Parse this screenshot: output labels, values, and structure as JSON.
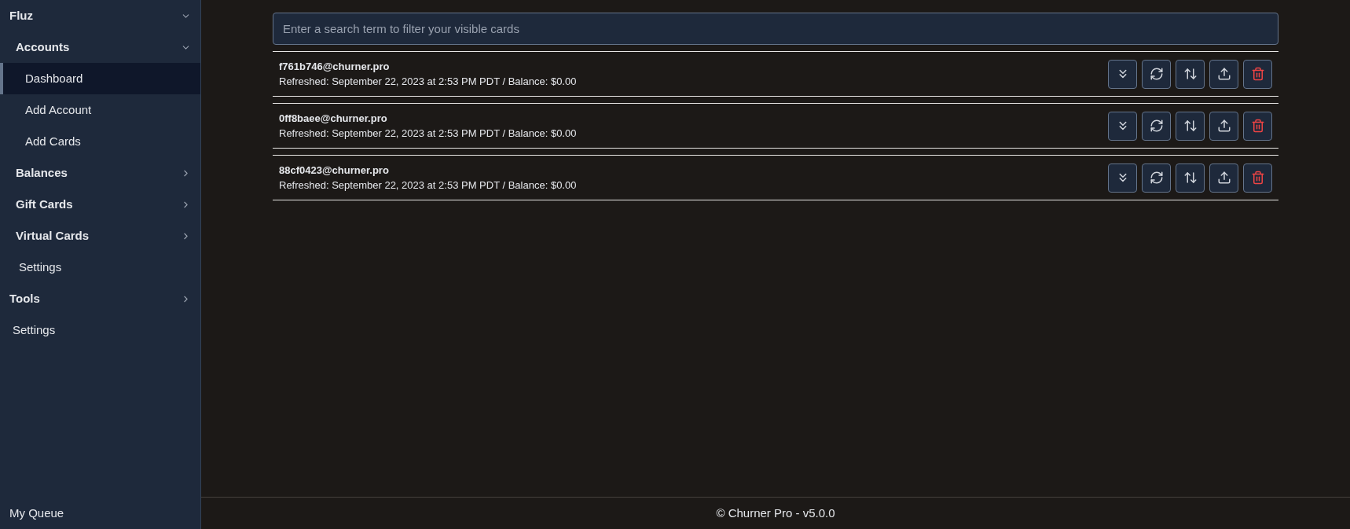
{
  "sidebar": {
    "items": [
      {
        "kind": "group",
        "label": "Fluz",
        "expanded": true,
        "children": [
          {
            "kind": "group",
            "label": "Accounts",
            "expanded": true,
            "children": [
              {
                "kind": "link",
                "label": "Dashboard",
                "selected": true
              },
              {
                "kind": "link",
                "label": "Add Account",
                "selected": false
              },
              {
                "kind": "link",
                "label": "Add Cards",
                "selected": false
              }
            ]
          },
          {
            "kind": "group",
            "label": "Balances",
            "expanded": false
          },
          {
            "kind": "group",
            "label": "Gift Cards",
            "expanded": false
          },
          {
            "kind": "group",
            "label": "Virtual Cards",
            "expanded": false
          },
          {
            "kind": "link",
            "label": "Settings",
            "selected": false
          }
        ]
      },
      {
        "kind": "group",
        "label": "Tools",
        "expanded": false
      },
      {
        "kind": "link",
        "label": "Settings",
        "selected": false
      }
    ],
    "bottom_item": "My Queue"
  },
  "search": {
    "placeholder": "Enter a search term to filter your visible cards"
  },
  "accounts": [
    {
      "email": "f761b746@churner.pro",
      "status": "Refreshed: September 22, 2023 at 2:53 PM PDT / Balance: $0.00"
    },
    {
      "email": "0ff8baee@churner.pro",
      "status": "Refreshed: September 22, 2023 at 2:53 PM PDT / Balance: $0.00"
    },
    {
      "email": "88cf0423@churner.pro",
      "status": "Refreshed: September 22, 2023 at 2:53 PM PDT / Balance: $0.00"
    }
  ],
  "footer": "© Churner Pro - v5.0.0"
}
